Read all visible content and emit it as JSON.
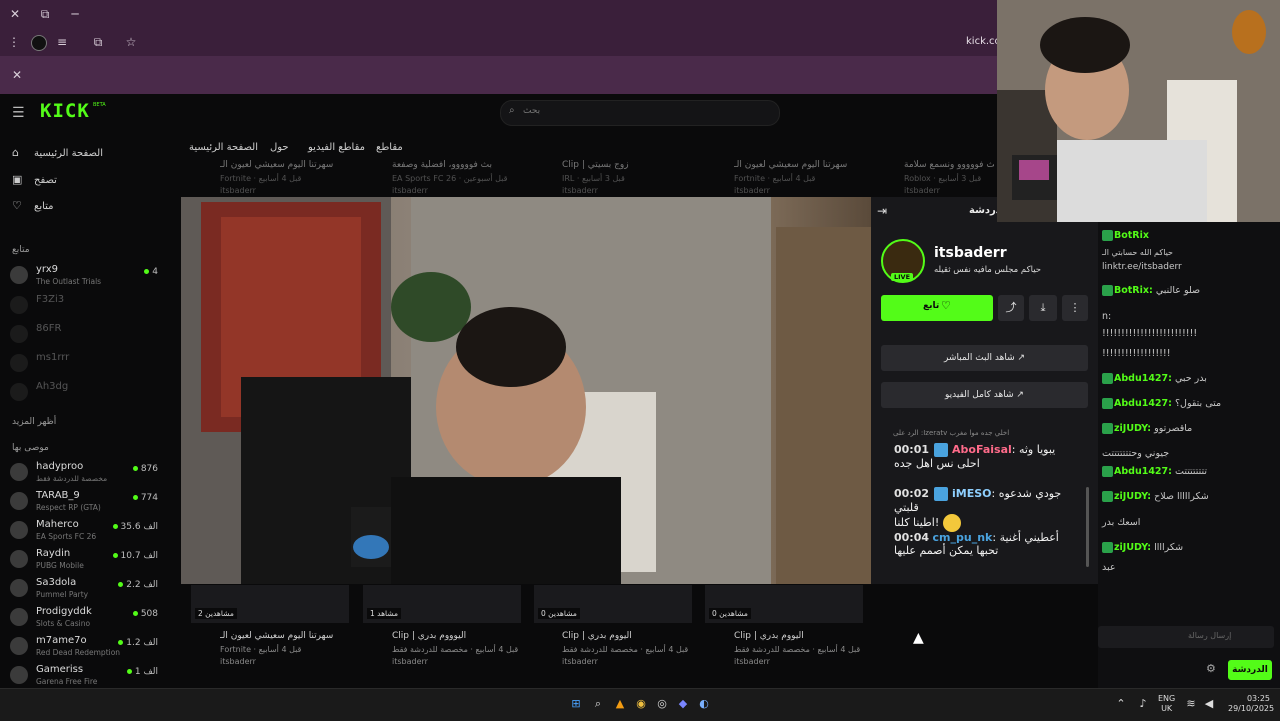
{
  "browser": {
    "close_label": "✕",
    "restore_label": "⧉",
    "minimize_label": "─",
    "url": "kick.cor",
    "infobar_close": "✕"
  },
  "kick": {
    "logo": "KICK",
    "logo_beta": "BETA",
    "search_placeholder": "بحث",
    "nav": [
      {
        "label": "الصفحة الرئيسية"
      },
      {
        "label": "تصفح"
      },
      {
        "label": "متابع"
      }
    ],
    "following_label": "متابع",
    "more_label": "أظهر المزيد",
    "recommended_label": "موصى بها",
    "followed_channels": [
      {
        "name": "yrx9",
        "game": "The Outlast Trials",
        "viewers": "4"
      },
      {
        "name": "F3Zi3",
        "game": "",
        "viewers": ""
      },
      {
        "name": "86FR",
        "game": "",
        "viewers": ""
      },
      {
        "name": "ms1rrr",
        "game": "",
        "viewers": ""
      },
      {
        "name": "Ah3dg",
        "game": "",
        "viewers": ""
      }
    ],
    "recommended_channels": [
      {
        "name": "hadyproo",
        "game": "مخصصة للدردشة فقط",
        "viewers": "876"
      },
      {
        "name": "TARAB_9",
        "game": "Respect RP (GTA)",
        "viewers": "774"
      },
      {
        "name": "Maherco",
        "game": "EA Sports FC 26",
        "viewers": "35.6 الف"
      },
      {
        "name": "Raydin",
        "game": "PUBG Mobile",
        "viewers": "10.7 الف"
      },
      {
        "name": "Sa3dola",
        "game": "Pummel Party",
        "viewers": "2.2 الف"
      },
      {
        "name": "Prodigyddk",
        "game": "Slots & Casino",
        "viewers": "508"
      },
      {
        "name": "m7ame7o",
        "game": "Red Dead Redemption",
        "viewers": "1.2 الف"
      },
      {
        "name": "Gameriss",
        "game": "Garena Free Fire",
        "viewers": "1 الف"
      }
    ],
    "tabs": [
      {
        "label": "الصفحة الرئيسية"
      },
      {
        "label": "حول"
      },
      {
        "label": "مقاطع الفيديو"
      },
      {
        "label": "مقاطع"
      }
    ],
    "top_cards": [
      {
        "title": "سهرتنا اليوم سعيشي لعيون الـ",
        "sub": "Fortnite · قبل 4 أسابيع",
        "author": "itsbaderr"
      },
      {
        "title": "بث فووووو، أفضلية وصفعة",
        "sub": "EA Sports FC 26 · قبل أسبوعين",
        "author": "itsbaderr"
      },
      {
        "title": "Clip | زوج بسيتي",
        "sub": "IRL · قبل 3 أسابيع",
        "author": "itsbaderr"
      },
      {
        "title": "سهرتنا اليوم سعيشي لعيون الـ",
        "sub": "Fortnite · قبل 4 أسابيع",
        "author": "itsbaderr"
      },
      {
        "title": "بث فووووو ونسمع سلامة",
        "sub": "Roblox · قبل 3 أسابيع",
        "author": "itsbaderr"
      }
    ],
    "bottom_cards": [
      {
        "badge": "مشاهدين 2",
        "title": "سهرتنا اليوم سعيشي لعيون الـ",
        "sub": "Fortnite · قبل 4 أسابيع",
        "author": "itsbaderr"
      },
      {
        "badge": "مشاهد 1",
        "title": "Clip | اليوووم بدري",
        "sub": "قبل 4 أسابيع · مخصصة للدردشة فقط",
        "author": "itsbaderr"
      },
      {
        "badge": "مشاهدين 0",
        "title": "Clip | اليووم بدري",
        "sub": "قبل 4 أسابيع · مخصصة للدردشة فقط",
        "author": "itsbaderr"
      },
      {
        "badge": "مشاهدين 0",
        "title": "Clip | اليووم بدري",
        "sub": "قبل 4 أسابيع · مخصصة للدردشة فقط",
        "author": "itsbaderr"
      }
    ]
  },
  "panel": {
    "title": "الدردشة",
    "streamer": "itsbaderr",
    "live_badge": "LIVE",
    "status": "حياكم مجلس مافيه نفس ثقيله",
    "follow_label": "تابع",
    "watch_live_label": "شاهد البث المباشر",
    "watch_full_label": "شاهد كامل الفيديو",
    "reply_hint": "الرد على :Izeratv اخلي جده موا مغرب",
    "messages": [
      {
        "time": "00:01",
        "user": "AboFaisal",
        "text": "يبويا وثه",
        "line2": "احلى نس اهل جده"
      },
      {
        "time": "00:02",
        "user": "iMESO",
        "text": "جودي شدعوه قلبتي",
        "line2": "اطينا كلنا!"
      },
      {
        "time": "00:04",
        "user": "cm_pu_nk",
        "text": "أعطيني أغنية",
        "line2": "تحبها يمكن أصمم عليها"
      }
    ]
  },
  "right_chat": {
    "pinned_user": "BotRix",
    "pinned_line1": "حياكم الله حسابتي الـ",
    "pinned_link": "linktr.ee/itsbaderr",
    "messages": [
      {
        "user": "BotRix:",
        "text": "صلو عالنبي"
      },
      {
        "user": "",
        "text": "n:"
      },
      {
        "user": "",
        "text": "!!!!!!!!!!!!!!!!!!!!!!!!!"
      },
      {
        "user": "",
        "text": "!!!!!!!!!!!!!!!!!!"
      },
      {
        "user": "Abdu1427:",
        "text": "بدر حبي"
      },
      {
        "user": "Abdu1427:",
        "text": "متى بتقول؟"
      },
      {
        "user": "ziJUDY:",
        "text": "ماقصرتوو"
      },
      {
        "user": "",
        "text": "جيوني وحتتتتتتتت"
      },
      {
        "user": "Abdu1427:",
        "text": "تتتتتتتتت"
      },
      {
        "user": "ziJUDY:",
        "text": "شكرااااا صلاح"
      },
      {
        "user": "",
        "text": "اسعك بدر"
      },
      {
        "user": "ziJUDY:",
        "text": "شكراااا"
      },
      {
        "user": "",
        "text": "عبد"
      }
    ],
    "input_placeholder": "إرسال رسالة",
    "send_label": "الدردشة"
  },
  "taskbar": {
    "lang_line1": "ENG",
    "lang_line2": "UK",
    "time": "03:25",
    "date": "29/10/2025"
  }
}
